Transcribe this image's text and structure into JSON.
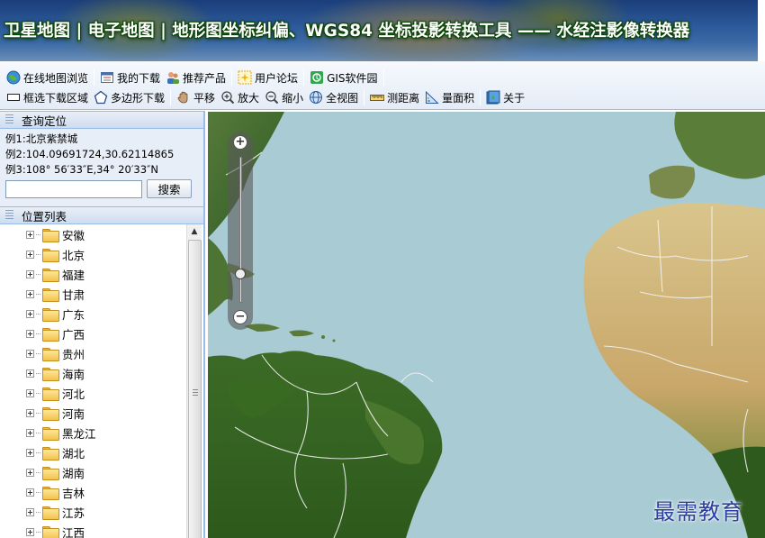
{
  "banner": {
    "title": "卫星地图 | 电子地图 | 地形图坐标纠偏、WGS84 坐标投影转换工具 —— 水经注影像转换器"
  },
  "toolbar": {
    "row1": [
      {
        "label": "在线地图浏览",
        "icon": "globe-icon"
      },
      {
        "label": "我的下载",
        "icon": "download-list-icon"
      },
      {
        "label": "推荐产品",
        "icon": "people-icon"
      },
      {
        "label": "用户论坛",
        "icon": "forum-icon"
      },
      {
        "label": "GIS软件园",
        "icon": "gis-icon"
      }
    ],
    "row2": [
      {
        "label": "框选下载区域",
        "icon": "rectangle-select-icon"
      },
      {
        "label": "多边形下载",
        "icon": "polygon-icon"
      },
      {
        "label": "平移",
        "icon": "pan-icon"
      },
      {
        "label": "放大",
        "icon": "zoom-in-icon"
      },
      {
        "label": "缩小",
        "icon": "zoom-out-icon"
      },
      {
        "label": "全视图",
        "icon": "full-extent-icon"
      },
      {
        "label": "测距离",
        "icon": "ruler-icon"
      },
      {
        "label": "量面积",
        "icon": "area-icon"
      },
      {
        "label": "关于",
        "icon": "about-icon"
      }
    ]
  },
  "query_panel": {
    "title": "查询定位",
    "examples": [
      "例1:北京紫禁城",
      "例2:104.09691724,30.62114865",
      "例3:108° 56′33″E,34° 20′33″N"
    ],
    "search_value": "",
    "search_button": "搜索"
  },
  "location_panel": {
    "title": "位置列表",
    "items": [
      "安徽",
      "北京",
      "福建",
      "甘肃",
      "广东",
      "广西",
      "贵州",
      "海南",
      "河北",
      "河南",
      "黑龙江",
      "湖北",
      "湖南",
      "吉林",
      "江苏",
      "江西"
    ]
  },
  "map": {
    "zoom_in": "+",
    "zoom_out": "−",
    "zoom_level_fraction": 0.2
  },
  "watermark": "最需教育",
  "colors": {
    "ocean": "#a9cbd3",
    "panel_border": "#99bbe8",
    "banner_text_outline": "#0b4a07"
  }
}
